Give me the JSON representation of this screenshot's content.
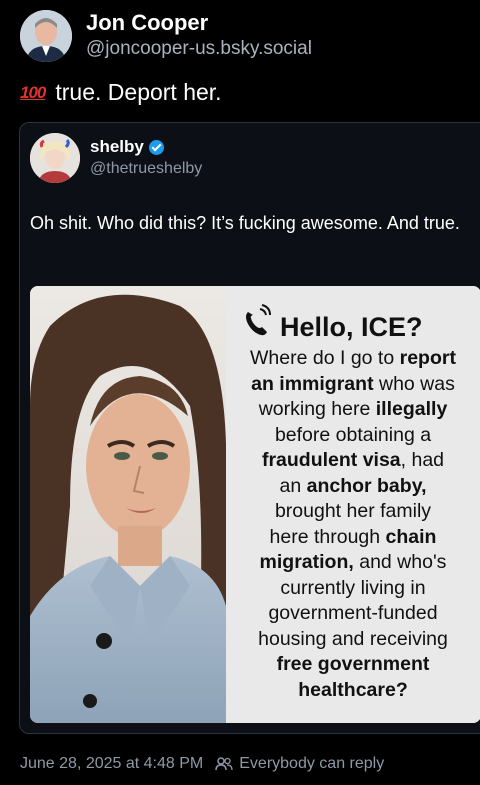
{
  "post": {
    "author": {
      "name": "Jon Cooper",
      "handle": "@joncooper-us.bsky.social"
    },
    "text": "true. Deport her.",
    "emoji": "100-emoji",
    "emoji_text": "100"
  },
  "quote": {
    "author": {
      "name": "shelby",
      "handle": "@thetrueshelby",
      "verified": true
    },
    "text": "Oh shit. Who did this? It’s fucking awesome. And true.",
    "image": {
      "title": "Hello, ICE?",
      "lines": [
        [
          {
            "t": "Where do I go to "
          },
          {
            "t": "report",
            "b": true
          }
        ],
        [
          {
            "t": "an immigrant",
            "b": true
          },
          {
            "t": " who was"
          }
        ],
        [
          {
            "t": "working here "
          },
          {
            "t": "illegally",
            "b": true
          }
        ],
        [
          {
            "t": "before obtaining a"
          }
        ],
        [
          {
            "t": "fraudulent visa",
            "b": true
          },
          {
            "t": ", had"
          }
        ],
        [
          {
            "t": "an "
          },
          {
            "t": "anchor baby,",
            "b": true
          }
        ],
        [
          {
            "t": "brought her family"
          }
        ],
        [
          {
            "t": "here through "
          },
          {
            "t": "chain",
            "b": true
          }
        ],
        [
          {
            "t": "migration,",
            "b": true
          },
          {
            "t": " and who's"
          }
        ],
        [
          {
            "t": "currently living in"
          }
        ],
        [
          {
            "t": "government-funded"
          }
        ],
        [
          {
            "t": "housing and receiving"
          }
        ],
        [
          {
            "t": "free government",
            "b": true
          }
        ],
        [
          {
            "t": "healthcare?",
            "b": true
          }
        ]
      ]
    }
  },
  "footer": {
    "timestamp": "June 28, 2025 at 4:48 PM",
    "reply_setting": "Everybody can reply"
  },
  "colors": {
    "background": "#000000",
    "secondary_text": "#8d99a6",
    "verified": "#1d9bf0",
    "emoji_red": "#e0332d"
  }
}
